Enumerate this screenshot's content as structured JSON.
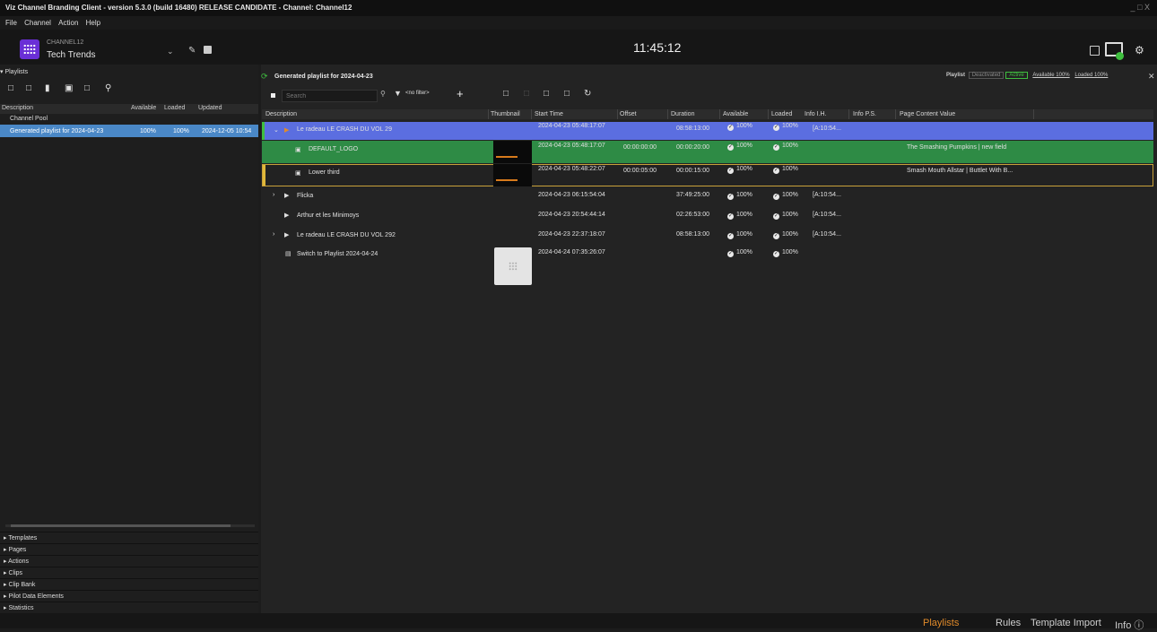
{
  "window": {
    "title": "Viz Channel Branding Client - version 5.3.0 (build 16480) RELEASE CANDIDATE -  Channel: Channel12",
    "controls": "_ □ X"
  },
  "menu": [
    "File",
    "Channel",
    "Action",
    "Help"
  ],
  "channel": {
    "name": "CHANNEL12",
    "title": "Tech Trends"
  },
  "clock": "11:45:12",
  "left": {
    "section": "▾ Playlists",
    "columns": {
      "description": "Description",
      "available": "Available",
      "loaded": "Loaded",
      "updated": "Updated"
    },
    "rows": [
      {
        "description": "Channel Pool",
        "available": "",
        "loaded": "",
        "updated": ""
      },
      {
        "description": "Generated playlist for 2024-04-23",
        "available": "100%",
        "loaded": "100%",
        "updated": "2024-12-05 10:54"
      }
    ],
    "accordion": [
      "▸ Templates",
      "▸ Pages",
      "▸ Actions",
      "▸ Clips",
      "▸ Clip Bank",
      "▸ Pilot Data Elements",
      "▸ Statistics"
    ]
  },
  "right": {
    "title": "Generated playlist for 2024-04-23",
    "status": {
      "playlist": "Playlist",
      "deactivated": "Deactivated",
      "active": "Active",
      "available": "Available  100%",
      "loaded": "Loaded   100%"
    },
    "search": {
      "placeholder": "Search"
    },
    "filter": "<no filter>",
    "columns": {
      "description": "Description",
      "thumbnail": "Thumbnail",
      "start": "Start Time",
      "offset": "Offset",
      "duration": "Duration",
      "available": "Available",
      "loaded": "Loaded",
      "info_ih": "Info I.H.",
      "info_ps": "Info P.S.",
      "page_content": "Page Content Value"
    },
    "rows": [
      {
        "description": "Le radeau LE CRASH DU VOL 29",
        "start": "2024-04-23  05:48:17:07",
        "offset": "",
        "duration": "08:58:13:00",
        "available": "100%",
        "loaded": "100%",
        "info": "[A:10:54...",
        "page": ""
      },
      {
        "description": "DEFAULT_LOGO",
        "start": "2024-04-23  05:48:17:07",
        "offset": "00:00:00:00",
        "duration": "00:00:20:00",
        "available": "100%",
        "loaded": "100%",
        "info": "",
        "page": "The Smashing Pumpkins | new field"
      },
      {
        "description": "Lower third",
        "start": "2024-04-23  05:48:22:07",
        "offset": "00:00:05:00",
        "duration": "00:00:15:00",
        "available": "100%",
        "loaded": "100%",
        "info": "",
        "page": "Smash Mouth Allstar | Buttlet With B..."
      },
      {
        "description": "Flicka",
        "start": "2024-04-23  06:15:54:04",
        "offset": "",
        "duration": "37:49:25:00",
        "available": "100%",
        "loaded": "100%",
        "info": "[A:10:54...",
        "page": ""
      },
      {
        "description": "Arthur et les Minimoys",
        "start": "2024-04-23  20:54:44:14",
        "offset": "",
        "duration": "02:26:53:00",
        "available": "100%",
        "loaded": "100%",
        "info": "[A:10:54...",
        "page": ""
      },
      {
        "description": "Le radeau LE CRASH DU VOL 292",
        "start": "2024-04-23  22:37:18:07",
        "offset": "",
        "duration": "08:58:13:00",
        "available": "100%",
        "loaded": "100%",
        "info": "[A:10:54...",
        "page": ""
      },
      {
        "description": "Switch to Playlist 2024-04-24",
        "start": "2024-04-24  07:35:26:07",
        "offset": "",
        "duration": "",
        "available": "100%",
        "loaded": "100%",
        "info": "",
        "page": ""
      }
    ]
  },
  "footer": {
    "playlists": "Playlists",
    "rules": "Rules",
    "template_import": "Template Import",
    "info": "Info ⓘ"
  },
  "colors": {
    "selected_row": "#5b6ee0",
    "green_row": "#2e8b45",
    "accent_orange": "#e08a2a",
    "active_green": "#3fbf3f"
  }
}
